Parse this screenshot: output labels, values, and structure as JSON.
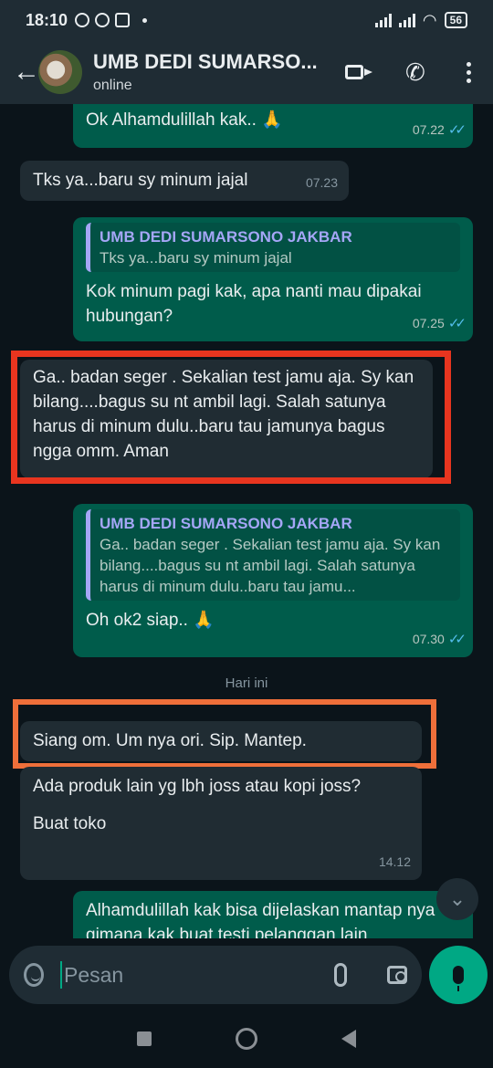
{
  "status": {
    "time": "18:10",
    "battery": "56"
  },
  "header": {
    "contact_name": "UMB DEDI SUMARSO...",
    "status": "online",
    "back_icon": "arrow-left-icon",
    "video_icon": "video-call-icon",
    "phone_icon": "phone-icon",
    "menu_icon": "more-vert-icon"
  },
  "messages": [
    {
      "dir": "out",
      "text": "Ok Alhamdulillah kak.. 🙏",
      "time": "07.22",
      "ticks": "✓✓"
    },
    {
      "dir": "in",
      "text": "Tks ya...baru sy minum jajal",
      "time": "07.23"
    },
    {
      "dir": "out",
      "quote_name": "UMB DEDI SUMARSONO JAKBAR",
      "quote_text": "Tks ya...baru sy minum jajal",
      "text": "Kok minum pagi kak, apa nanti mau dipakai hubungan?",
      "time": "07.25",
      "ticks": "✓✓"
    },
    {
      "dir": "in",
      "text": "Ga.. badan seger . Sekalian test jamu aja. Sy kan bilang....bagus su nt ambil lagi. Salah satunya harus di minum dulu..baru tau jamunya bagus ngga omm. Aman"
    },
    {
      "dir": "out",
      "quote_name": "UMB DEDI SUMARSONO JAKBAR",
      "quote_text": "Ga.. badan seger . Sekalian test jamu aja. Sy kan bilang....bagus su nt ambil lagi. Salah satunya harus di minum dulu..baru tau jamu...",
      "text": "Oh ok2 siap.. 🙏",
      "time": "07.30",
      "ticks": "✓✓"
    },
    {
      "dir": "in",
      "text": "Siang om. Um nya ori. Sip. Mantep."
    },
    {
      "dir": "in",
      "text_line1": "Ada produk lain yg lbh joss atau kopi joss?",
      "text_line2": "Buat toko",
      "time": "14.12"
    },
    {
      "dir": "out",
      "text": "Alhamdulillah kak bisa dijelaskan mantap nya gimana kak buat testi pelanggan lain"
    }
  ],
  "date_divider": "Hari ini",
  "composer": {
    "placeholder": "Pesan",
    "emoji_icon": "emoji-icon",
    "attach_icon": "paperclip-icon",
    "camera_icon": "camera-icon",
    "mic_icon": "mic-icon"
  },
  "colors": {
    "incoming_bubble": "#202c33",
    "outgoing_bubble": "#005c4b",
    "highlight_red": "#e8351f",
    "highlight_orange": "#ef6f3a",
    "accent": "#00a884"
  }
}
